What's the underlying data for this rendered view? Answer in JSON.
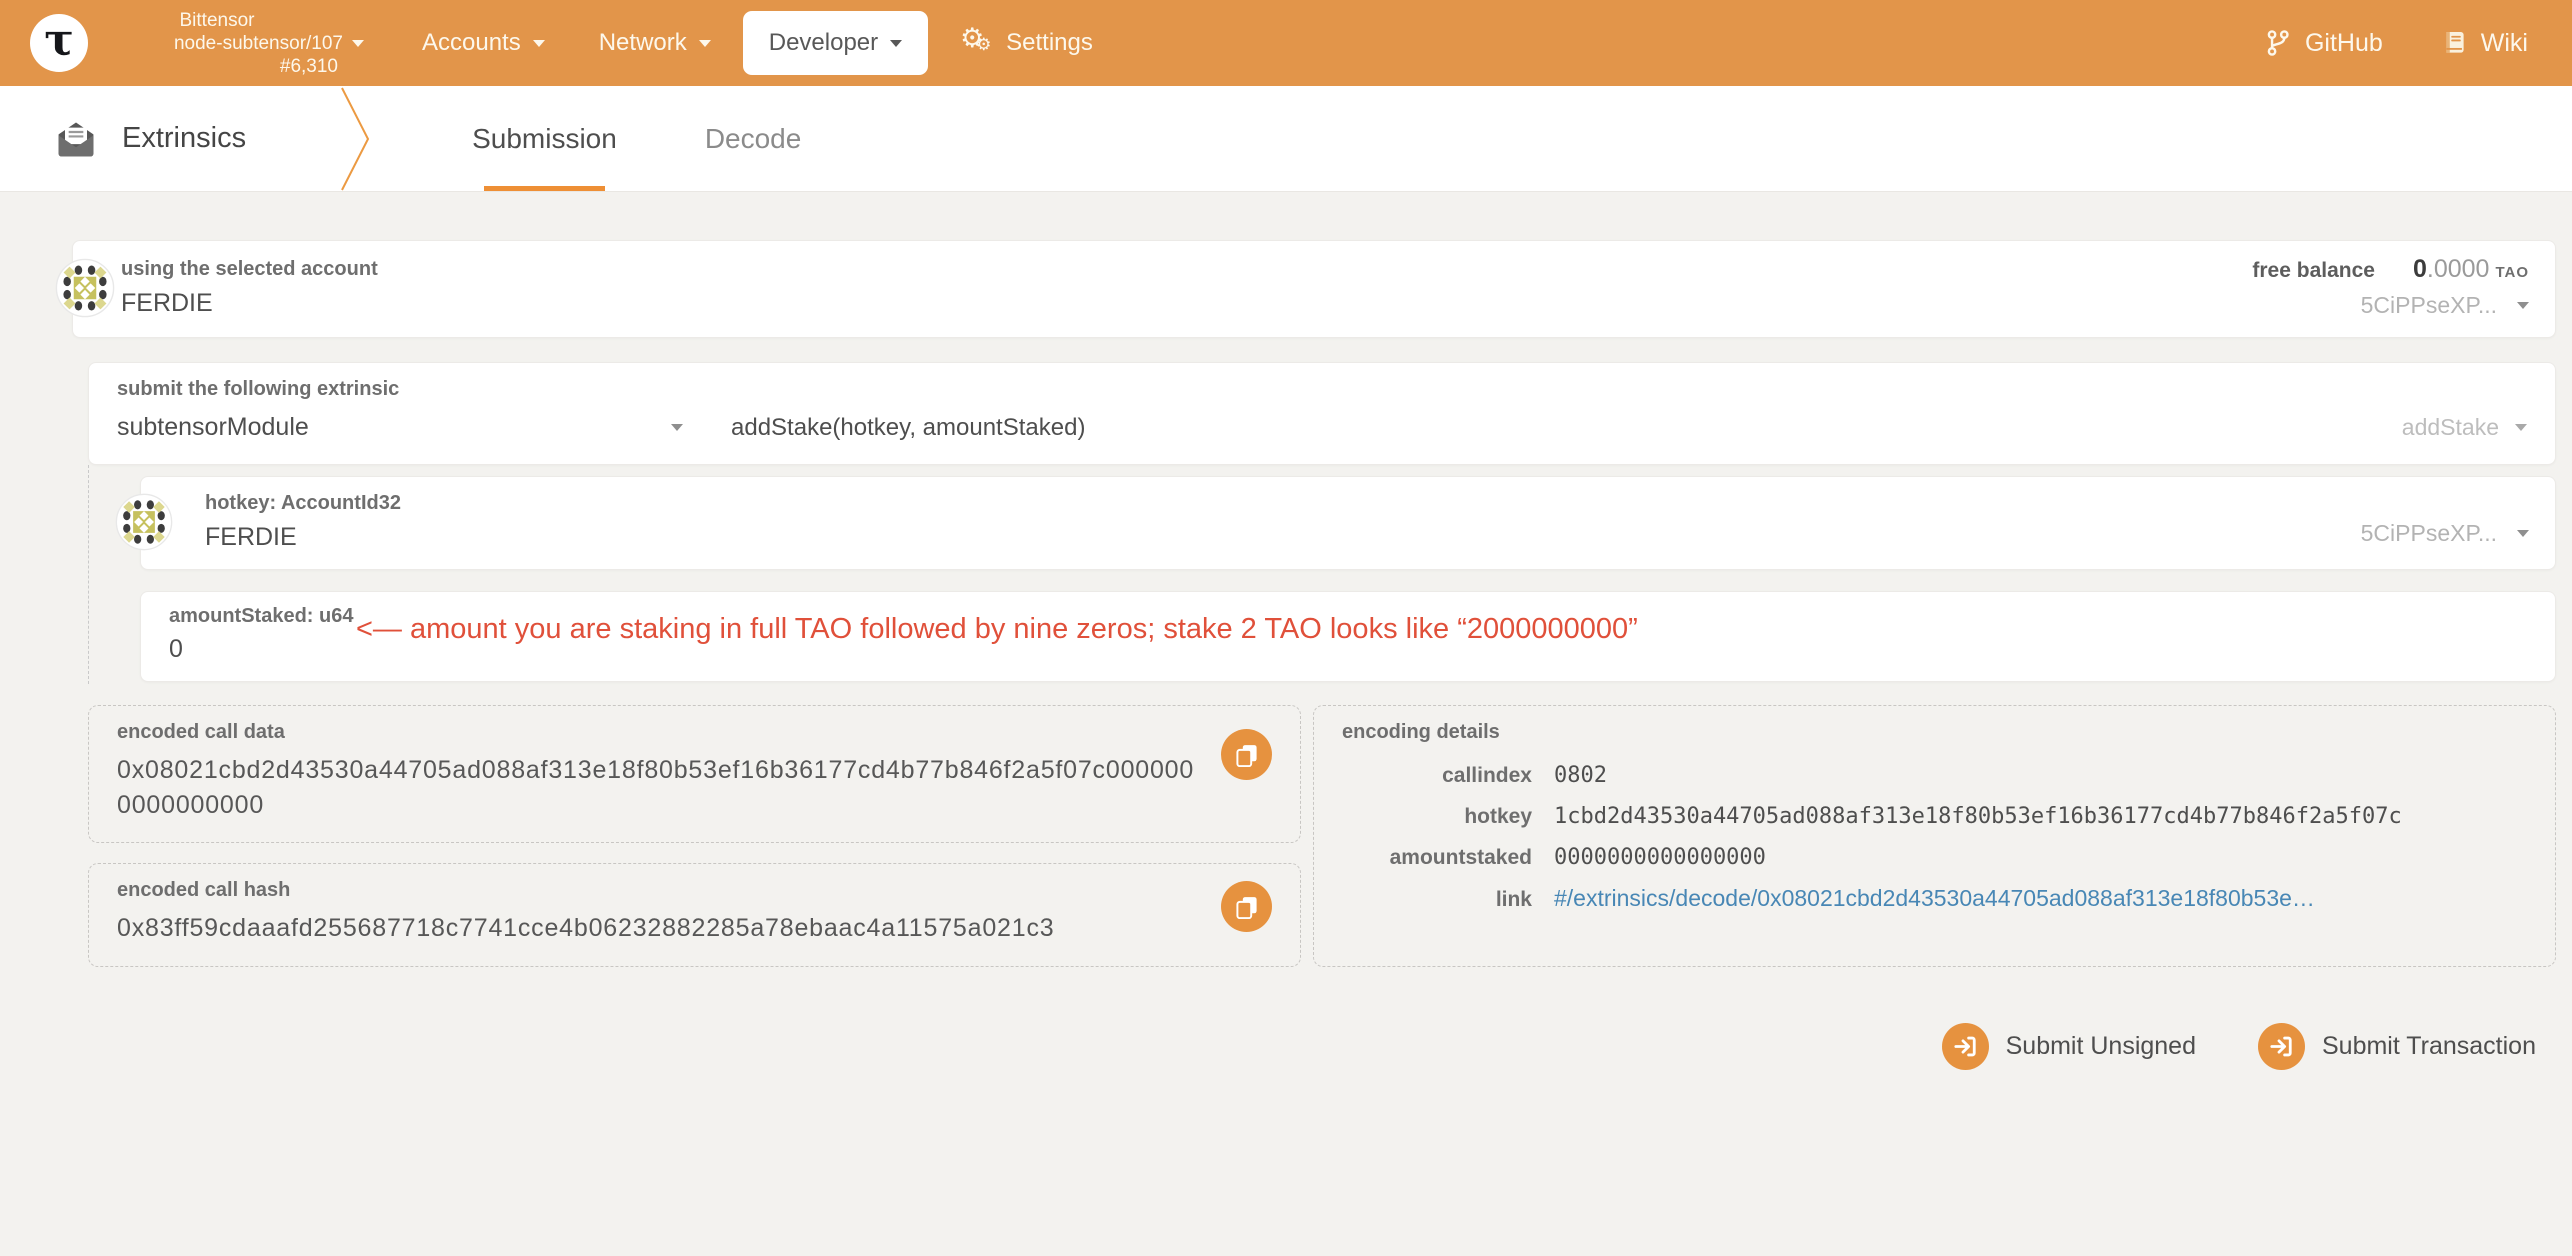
{
  "header": {
    "logo_glyph": "τ",
    "chain_name": "Bittensor",
    "node_name": "node-subtensor/107",
    "block_number": "#6,310",
    "nav": [
      {
        "label": "Accounts"
      },
      {
        "label": "Network"
      },
      {
        "label": "Developer"
      },
      {
        "label": "Settings"
      }
    ],
    "links": [
      {
        "label": "GitHub"
      },
      {
        "label": "Wiki"
      }
    ]
  },
  "tabbar": {
    "section": "Extrinsics",
    "tabs": [
      {
        "label": "Submission"
      },
      {
        "label": "Decode"
      }
    ]
  },
  "account_card": {
    "label": "using the selected account",
    "account": "FERDIE",
    "balance_label": "free balance",
    "balance_int": "0",
    "balance_frac": ".0000",
    "balance_unit": "TAO",
    "address_short": "5CiPPseXP..."
  },
  "extrinsic_card": {
    "label": "submit the following extrinsic",
    "module": "subtensorModule",
    "method_signature": "addStake(hotkey, amountStaked)",
    "method_short": "addStake"
  },
  "params": {
    "hotkey": {
      "label": "hotkey: AccountId32",
      "value": "FERDIE",
      "address_short": "5CiPPseXP..."
    },
    "amount": {
      "label": "amountStaked: u64",
      "value": "0",
      "annotation": "<— amount you are staking in full TAO followed by nine zeros; stake 2 TAO looks like “2000000000”"
    }
  },
  "outputs": {
    "call_data": {
      "label": "encoded call data",
      "value": "0x08021cbd2d43530a44705ad088af313e18f80b53ef16b36177cd4b77b846f2a5f07c0000000000000000"
    },
    "call_hash": {
      "label": "encoded call hash",
      "value": "0x83ff59cdaaafd255687718c7741cce4b06232882285a78ebaac4a11575a021c3"
    },
    "encoding_details": {
      "label": "encoding details",
      "rows": [
        {
          "key": "callindex",
          "value": "0802"
        },
        {
          "key": "hotkey",
          "value": "1cbd2d43530a44705ad088af313e18f80b53ef16b36177cd4b77b846f2a5f07c"
        },
        {
          "key": "amountstaked",
          "value": "0000000000000000"
        },
        {
          "key": "link",
          "value": "#/extrinsics/decode/0x08021cbd2d43530a44705ad088af313e18f80b53e…"
        }
      ]
    }
  },
  "actions": {
    "submit_unsigned": "Submit Unsigned",
    "submit_transaction": "Submit Transaction"
  },
  "colors": {
    "accent": "#e2954a",
    "tab_underline": "#ee8f35",
    "annotation_red": "#e0503a",
    "link_blue": "#4887b5"
  }
}
